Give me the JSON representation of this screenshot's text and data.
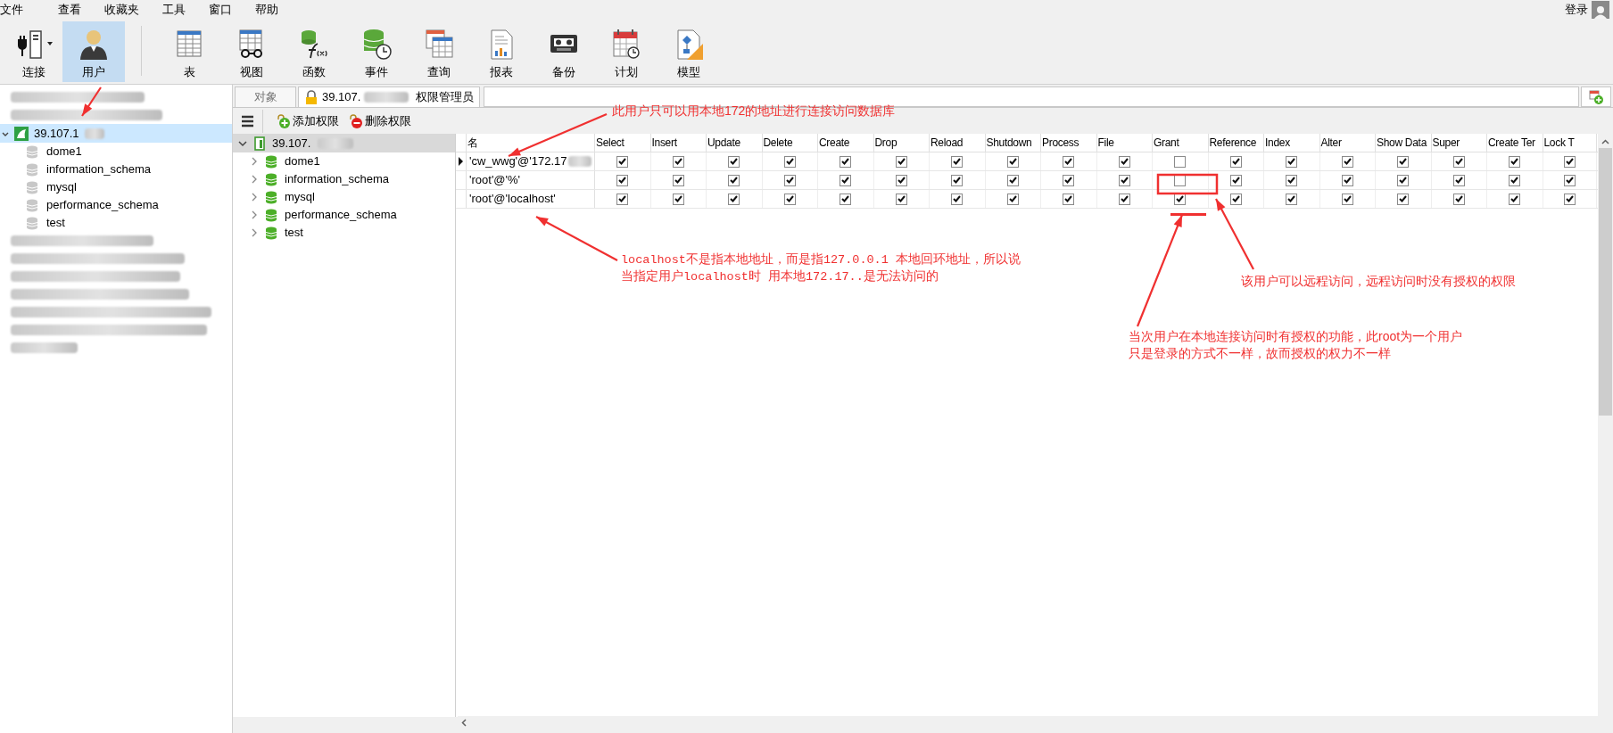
{
  "menu": [
    "文件",
    "查看",
    "收藏夹",
    "工具",
    "窗口",
    "帮助"
  ],
  "login": "登录",
  "toolbar": [
    {
      "label": "连接",
      "selected": false
    },
    {
      "label": "用户",
      "selected": true
    },
    {
      "label": "表",
      "selected": false
    },
    {
      "label": "视图",
      "selected": false
    },
    {
      "label": "函数",
      "selected": false
    },
    {
      "label": "事件",
      "selected": false
    },
    {
      "label": "查询",
      "selected": false
    },
    {
      "label": "报表",
      "selected": false
    },
    {
      "label": "备份",
      "selected": false
    },
    {
      "label": "计划",
      "selected": false
    },
    {
      "label": "模型",
      "selected": false
    }
  ],
  "connections": [
    {
      "kind": "blurred"
    },
    {
      "kind": "blurred"
    },
    {
      "kind": "connection",
      "label": "39.107.1",
      "selected": true,
      "expanded": true,
      "children": [
        {
          "label": "dome1"
        },
        {
          "label": "information_schema"
        },
        {
          "label": "mysql"
        },
        {
          "label": "performance_schema"
        },
        {
          "label": "test"
        }
      ]
    },
    {
      "kind": "blurred"
    },
    {
      "kind": "blurred"
    },
    {
      "kind": "blurred"
    },
    {
      "kind": "blurred"
    },
    {
      "kind": "blurred"
    },
    {
      "kind": "blurred"
    },
    {
      "kind": "blurred"
    }
  ],
  "tabs": [
    {
      "label": "对象",
      "selected": false
    },
    {
      "label": "39.107.",
      "suffix": "权限管理员",
      "selected": true
    }
  ],
  "actions": [
    "添加权限",
    "删除权限"
  ],
  "privilege_tree": {
    "label": "39.107.",
    "expanded": true,
    "children": [
      {
        "label": "dome1"
      },
      {
        "label": "information_schema"
      },
      {
        "label": "mysql"
      },
      {
        "label": "performance_schema"
      },
      {
        "label": "test"
      }
    ]
  },
  "grid": {
    "columns": [
      "名",
      "Select",
      "Insert",
      "Update",
      "Delete",
      "Create",
      "Drop",
      "Reload",
      "Shutdown",
      "Process",
      "File",
      "Grant",
      "Reference",
      "Index",
      "Alter",
      "Show Data",
      "Super",
      "Create Ter",
      "Lock T"
    ],
    "rows": [
      {
        "user": "'cw_wwg'@'172.17",
        "current": true,
        "privileges": [
          true,
          true,
          true,
          true,
          true,
          true,
          true,
          true,
          true,
          true,
          false,
          true,
          true,
          true,
          true,
          true,
          true,
          true
        ]
      },
      {
        "user": "'root'@'%'",
        "current": false,
        "privileges": [
          true,
          true,
          true,
          true,
          true,
          true,
          true,
          true,
          true,
          true,
          false,
          true,
          true,
          true,
          true,
          true,
          true,
          true
        ]
      },
      {
        "user": "'root'@'localhost'",
        "current": false,
        "privileges": [
          true,
          true,
          true,
          true,
          true,
          true,
          true,
          true,
          true,
          true,
          true,
          true,
          true,
          true,
          true,
          true,
          true,
          true
        ]
      }
    ]
  },
  "annotations": [
    {
      "lines": [
        "此用户只可以用本地172的地址进行连接访问数据库"
      ],
      "mono": false
    },
    {
      "lines": [
        "localhost不是指本地地址，而是指127.0.0.1 本地回环地址，所以说",
        "当指定用户localhost时 用本地172.17..是无法访问的"
      ],
      "mono": true
    },
    {
      "lines": [
        "该用户可以远程访问，远程访问时没有授权的权限"
      ],
      "mono": false
    },
    {
      "lines": [
        "当次用户在本地连接访问时有授权的功能，此root为一个用户",
        "只是登录的方式不一样，故而授权的权力不一样"
      ],
      "mono": false
    }
  ]
}
